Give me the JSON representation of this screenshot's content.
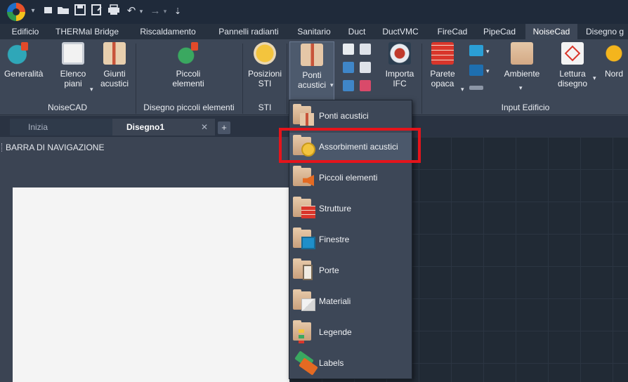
{
  "quick_access": {
    "icons": [
      "app-logo-icon",
      "new-file-icon",
      "open-folder-icon",
      "save-icon",
      "save-as-icon",
      "print-icon",
      "undo-icon",
      "redo-icon",
      "customize-icon"
    ],
    "undo_glyph": "↶",
    "redo_glyph": "→",
    "more_glyph": "▾"
  },
  "ribbon_tabs": [
    "Edificio",
    "THERMal Bridge",
    "Riscaldamento",
    "Pannelli radianti",
    "Sanitario",
    "Duct",
    "DuctVMC",
    "FireCad",
    "PipeCad",
    "NoiseCad",
    "Disegno g"
  ],
  "active_tab": "NoiseCad",
  "ribbon": {
    "buttons": {
      "generalita": "Generalità",
      "elenco_piani": "Elenco\npiani",
      "giunti_acustici": "Giunti\nacustici",
      "piccoli_elementi": "Piccoli\nelementi",
      "posizioni_sti": "Posizioni\nSTI",
      "ponti_acustici": "Ponti\nacustici",
      "importa_ifc": "Importa\nIFC",
      "parete_opaca": "Parete\nopaca",
      "ambiente": "Ambiente",
      "lettura_disegno": "Lettura\ndisegno",
      "nord": "Nord"
    },
    "groups": {
      "noisecad": "NoiseCAD",
      "disegno_piccoli": "Disegno piccoli elementi",
      "sti": "STI",
      "input_edificio": "Input Edificio"
    },
    "dropdown_arrow": "▾"
  },
  "doc_tabs": {
    "inizia": "Inizia",
    "disegno1": "Disegno1",
    "close": "✕",
    "add": "+"
  },
  "nav_panel": {
    "title": "BARRA DI NAVIGAZIONE"
  },
  "dropdown": {
    "items": [
      {
        "label": "Ponti acustici",
        "icon": "ponti-acustici-icon"
      },
      {
        "label": "Assorbimenti acustici",
        "icon": "assorbimenti-acustici-icon"
      },
      {
        "label": "Piccoli elementi",
        "icon": "piccoli-elementi-icon"
      },
      {
        "label": "Strutture",
        "icon": "strutture-icon"
      },
      {
        "label": "Finestre",
        "icon": "finestre-icon"
      },
      {
        "label": "Porte",
        "icon": "porte-icon"
      },
      {
        "label": "Materiali",
        "icon": "materiali-icon"
      },
      {
        "label": "Legende",
        "icon": "legende-icon"
      },
      {
        "label": "Labels",
        "icon": "labels-icon"
      }
    ],
    "highlighted_index": 1
  },
  "colors": {
    "highlight": "#e5141b",
    "ribbon_bg": "#3d4757",
    "canvas_bg": "#212a35"
  }
}
